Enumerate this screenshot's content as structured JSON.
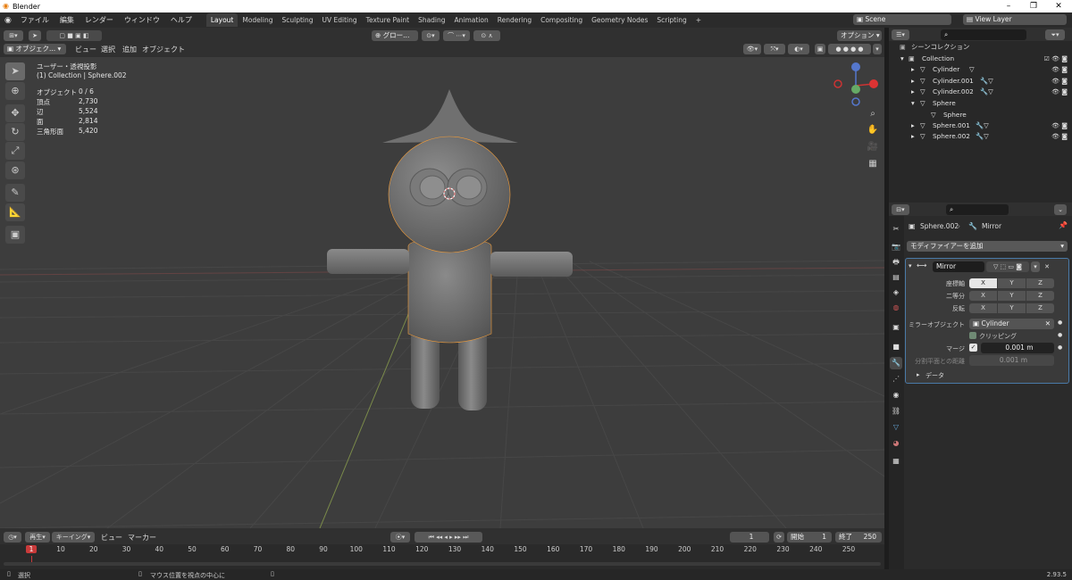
{
  "window": {
    "title": "Blender",
    "minimize": "–",
    "maximize": "❐",
    "close": "✕"
  },
  "menu": [
    "ファイル",
    "編集",
    "レンダー",
    "ウィンドウ",
    "ヘルプ"
  ],
  "workspaces": [
    "Layout",
    "Modeling",
    "Sculpting",
    "UV Editing",
    "Texture Paint",
    "Shading",
    "Animation",
    "Rendering",
    "Compositing",
    "Geometry Nodes",
    "Scripting",
    "+"
  ],
  "active_workspace": "Layout",
  "scene": {
    "name": "Scene",
    "view_layer": "View Layer"
  },
  "viewport_header": {
    "mode": "オブジェク...",
    "menus": [
      "ビュー",
      "選択",
      "追加",
      "オブジェクト"
    ],
    "transform_orientation": "グロー...",
    "options": "オプション"
  },
  "overlay_text": {
    "view_name": "ユーザー・透視投影",
    "collection_info": "(1) Collection | Sphere.002",
    "stats": [
      {
        "label": "オブジェクト",
        "value": "0 / 6"
      },
      {
        "label": "頂点",
        "value": "2,730"
      },
      {
        "label": "辺",
        "value": "5,524"
      },
      {
        "label": "面",
        "value": "2,814"
      },
      {
        "label": "三角形面",
        "value": "5,420"
      }
    ]
  },
  "outliner": {
    "title": "シーンコレクション",
    "collection": "Collection",
    "items": [
      "Cylinder",
      "Cylinder.001",
      "Cylinder.002",
      "Sphere",
      "Sphere",
      "Sphere.001",
      "Sphere.002"
    ]
  },
  "properties": {
    "breadcrumb_object": "Sphere.002",
    "breadcrumb_sep": "›",
    "breadcrumb_modifier": "Mirror",
    "add_modifier": "モディファイアーを追加",
    "modifier_name": "Mirror",
    "axis_label": "座標軸",
    "bisect_label": "二等分",
    "flip_label": "反転",
    "axes": [
      "X",
      "Y",
      "Z"
    ],
    "mirror_object_label": "ミラーオブジェクト",
    "mirror_object": "Cylinder",
    "clipping_label": "クリッピング",
    "merge_label": "マージ",
    "merge_value": "0.001 m",
    "bisect_distance_label": "分割平面との距離",
    "bisect_distance_value": "0.001 m",
    "data_label": "データ"
  },
  "timeline": {
    "playback": "再生",
    "keying": "キーイング",
    "view": "ビュー",
    "marker": "マーカー",
    "current_frame": "1",
    "start_label": "開始",
    "start": "1",
    "end_label": "終了",
    "end": "250",
    "ticks": [
      "1",
      "10",
      "20",
      "30",
      "40",
      "50",
      "60",
      "70",
      "80",
      "90",
      "100",
      "110",
      "120",
      "130",
      "140",
      "150",
      "160",
      "170",
      "180",
      "190",
      "200",
      "210",
      "220",
      "230",
      "240",
      "250"
    ]
  },
  "status": {
    "select": "選択",
    "center_view": "マウス位置を視点の中心に",
    "version": "2.93.5"
  },
  "colors": {
    "active_frame": "#c93a3a",
    "selected_outline": "#f29c38",
    "header": "#303030",
    "viewport": "#3d3d3d"
  }
}
